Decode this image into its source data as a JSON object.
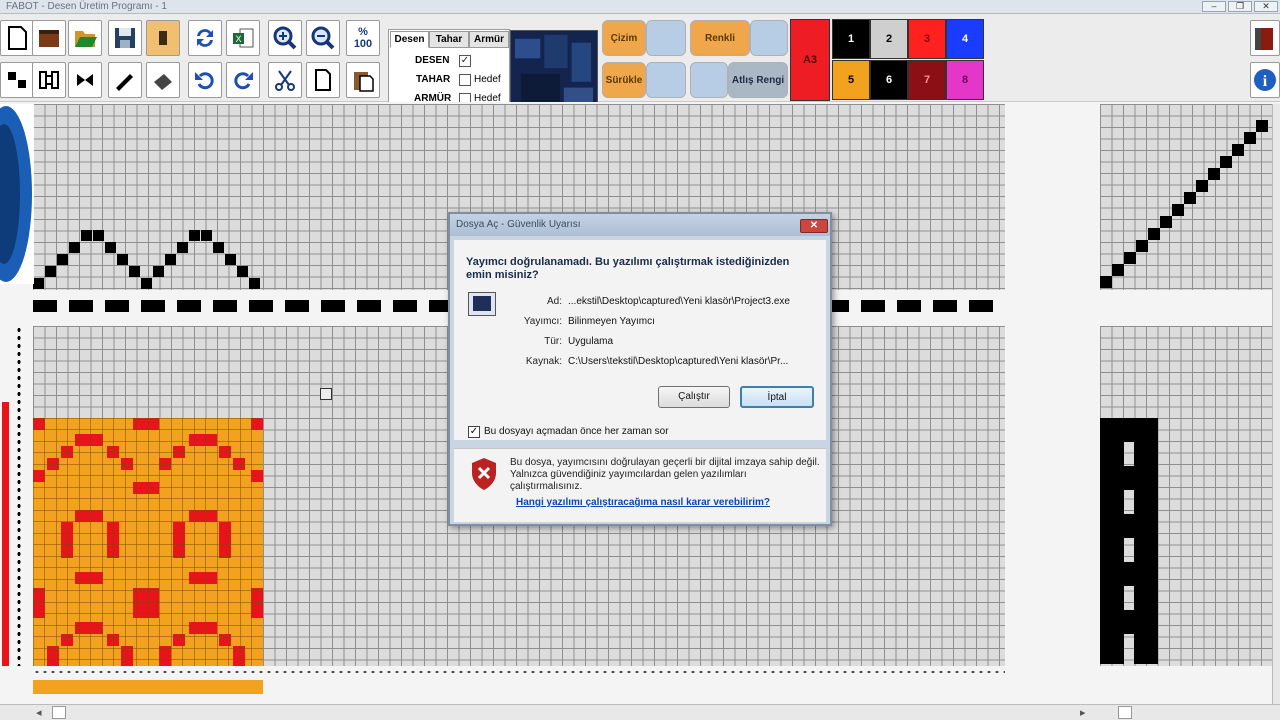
{
  "window": {
    "title": "FABOT - Desen Üretim Programı - 1",
    "controls": [
      "–",
      "❐",
      "✕"
    ]
  },
  "toolbar": {
    "zoom_symbol": "%",
    "zoom_value": "100",
    "tools": [
      "new-file-icon",
      "open-book-icon",
      "open-folder-icon",
      "save-icon",
      "palette-icon",
      "refresh-icon",
      "excel-icon",
      "zoom-in-icon",
      "zoom-out-icon",
      "grid-tool-icon",
      "flip-icon",
      "mirror-icon",
      "brush-icon",
      "fill-icon",
      "undo-icon",
      "redo-icon",
      "cut-icon",
      "copy-icon",
      "paste-icon"
    ]
  },
  "tabs": {
    "items": [
      "Desen",
      "Tahar",
      "Armür"
    ],
    "active": "Desen",
    "options": [
      {
        "label": "DESEN",
        "checked": true,
        "target": ""
      },
      {
        "label": "TAHAR",
        "checked": false,
        "target": "Hedef"
      },
      {
        "label": "ARMÜR",
        "checked": false,
        "target": "Hedef"
      }
    ]
  },
  "actions": {
    "cizim": "Çizim",
    "renkli": "Renkli",
    "surukle": "Sürükle",
    "atlis_rengi": "Atlış Rengi"
  },
  "palette": {
    "active_label": "A3",
    "colors": [
      {
        "label": "1",
        "color": "#000000"
      },
      {
        "label": "2",
        "color": "#cfcfcf"
      },
      {
        "label": "3",
        "color": "#ff2020"
      },
      {
        "label": "4",
        "color": "#1a3cff"
      },
      {
        "label": "5",
        "color": "#f2a21e"
      },
      {
        "label": "6",
        "color": "#000000"
      },
      {
        "label": "7",
        "color": "#8b0f14"
      },
      {
        "label": "8",
        "color": "#e436c8"
      }
    ]
  },
  "colors": {
    "pattern_orange": "#f2a21e",
    "pattern_red": "#e8131b",
    "accent_blue": "#1a5fb5"
  },
  "dialog": {
    "title": "Dosya Aç - Güvenlik Uyarısı",
    "close": "✕",
    "heading": "Yayımcı doğrulanamadı. Bu yazılımı çalıştırmak istediğinizden emin misiniz?",
    "rows": [
      {
        "label": "Ad:",
        "value": "...ekstil\\Desktop\\captured\\Yeni klasör\\Project3.exe"
      },
      {
        "label": "Yayımcı:",
        "value": "Bilinmeyen Yayımcı"
      },
      {
        "label": "Tür:",
        "value": "Uygulama"
      },
      {
        "label": "Kaynak:",
        "value": "C:\\Users\\tekstil\\Desktop\\captured\\Yeni klasör\\Pr..."
      }
    ],
    "run_button": "Çalıştır",
    "cancel_button": "İptal",
    "checkbox_label": "Bu dosyayı açmadan önce her zaman sor",
    "checkbox_checked": true,
    "warning_text": "Bu dosya, yayımcısını doğrulayan geçerli bir dijital imzaya sahip değil. Yalnızca güvendiğiniz yayımcılardan gelen yazılımları çalıştırmalısınız.",
    "help_link": "Hangi yazılımı çalıştıracağıma nasıl karar verebilirim?"
  },
  "scrollbar": {
    "left": "◂",
    "right": "▸"
  }
}
